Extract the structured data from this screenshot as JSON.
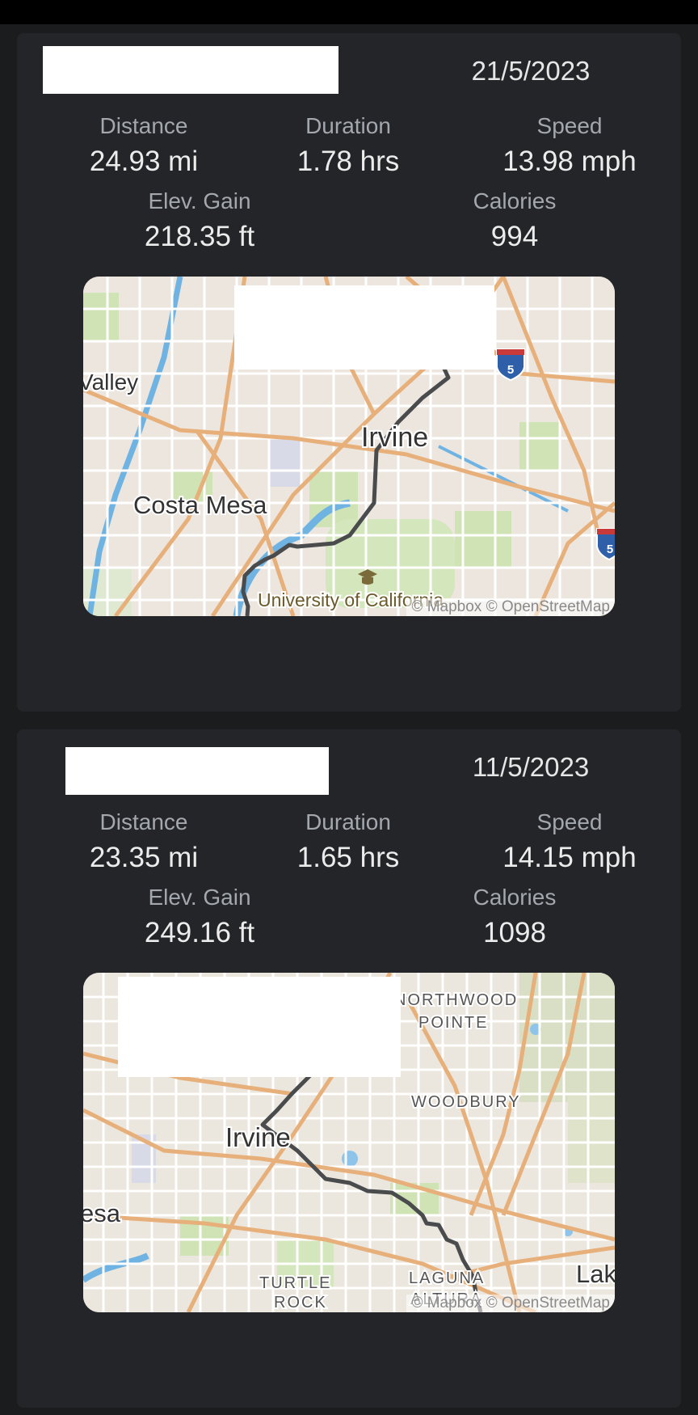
{
  "activities": [
    {
      "date": "21/5/2023",
      "stats": {
        "distance": {
          "label": "Distance",
          "value": "24.93 mi"
        },
        "duration": {
          "label": "Duration",
          "value": "1.78 hrs"
        },
        "speed": {
          "label": "Speed",
          "value": "13.98 mph"
        },
        "elev_gain": {
          "label": "Elev. Gain",
          "value": "218.35 ft"
        },
        "calories": {
          "label": "Calories",
          "value": "994"
        }
      },
      "map": {
        "labels": {
          "valley": "Valley",
          "irvine": "Irvine",
          "costa_mesa": "Costa Mesa",
          "university": "University of California",
          "shield_1": "5",
          "shield_2": "5"
        },
        "attribution": "© Mapbox © OpenStreetMap"
      }
    },
    {
      "date": "11/5/2023",
      "stats": {
        "distance": {
          "label": "Distance",
          "value": "23.35 mi"
        },
        "duration": {
          "label": "Duration",
          "value": "1.65 hrs"
        },
        "speed": {
          "label": "Speed",
          "value": "14.15 mph"
        },
        "elev_gain": {
          "label": "Elev. Gain",
          "value": "249.16 ft"
        },
        "calories": {
          "label": "Calories",
          "value": "1098"
        }
      },
      "map": {
        "labels": {
          "northwood": "NORTHWOOD",
          "pointe": "POINTE",
          "woodbury": "WOODBURY",
          "irvine": "Irvine",
          "mesa": "esa",
          "turtle": "TURTLE",
          "rock": "ROCK",
          "laguna": "LAGUNA",
          "altura": "ALTURA",
          "lake": "Lak"
        },
        "attribution": "© Mapbox © OpenStreetMap"
      }
    }
  ],
  "colors": {
    "background": "#1b1c1e",
    "card": "#242528",
    "label": "#a3a7ae",
    "value": "#ececec",
    "route": "#4a4b4d",
    "road_major": "#e7b07a"
  }
}
